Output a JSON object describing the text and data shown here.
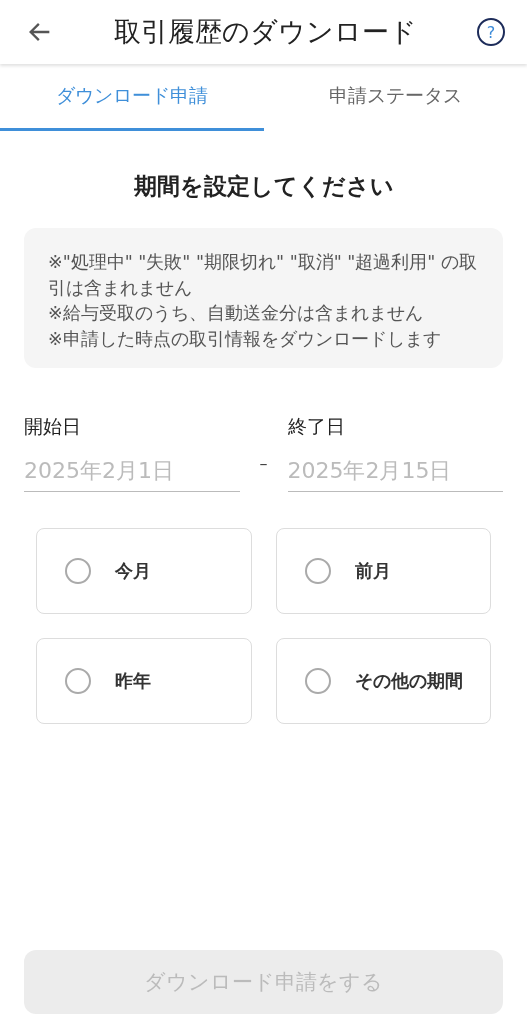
{
  "header": {
    "title": "取引履歴のダウンロード",
    "help": "?"
  },
  "tabs": [
    {
      "label": "ダウンロード申請",
      "selected": true
    },
    {
      "label": "申請ステータス",
      "selected": false
    }
  ],
  "heading": "期間を設定してください",
  "notes": [
    "※\"処理中\" \"失敗\" \"期限切れ\" \"取消\" \"超過利用\" の取引は含まれません",
    "※給与受取のうち、自動送金分は含まれません",
    "※申請した時点の取引情報をダウンロードします"
  ],
  "start": {
    "label": "開始日",
    "placeholder": "2025年2月1日"
  },
  "separator": "–",
  "end": {
    "label": "終了日",
    "placeholder": "2025年2月15日"
  },
  "periods": [
    {
      "label": "今月",
      "selected": false
    },
    {
      "label": "前月",
      "selected": false
    },
    {
      "label": "昨年",
      "selected": false
    },
    {
      "label": "その他の期間",
      "selected": false
    }
  ],
  "submit": {
    "label": "ダウンロード申請をする",
    "disabled": true
  }
}
